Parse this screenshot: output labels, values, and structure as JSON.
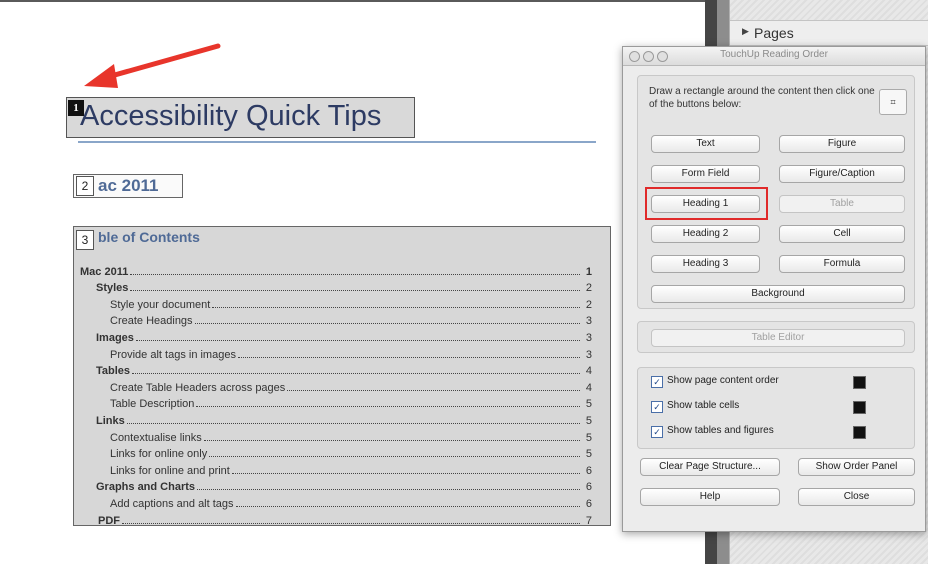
{
  "document": {
    "heading1_tag": "1",
    "heading1_text": "Accessibility Quick Tips",
    "heading2_tag": "2",
    "heading2_text": "ac 2011",
    "toc_tag": "3",
    "toc_title": "ble of Contents",
    "toc_entries": [
      {
        "label": "Mac 2011",
        "page": "1"
      },
      {
        "label": "Styles",
        "page": "2"
      },
      {
        "label": "Style your document",
        "page": "2"
      },
      {
        "label": "Create Headings",
        "page": "3"
      },
      {
        "label": "Images",
        "page": "3"
      },
      {
        "label": "Provide alt tags in images",
        "page": "3"
      },
      {
        "label": "Tables",
        "page": "4"
      },
      {
        "label": "Create Table Headers across pages",
        "page": "4"
      },
      {
        "label": "Table Description",
        "page": "5"
      },
      {
        "label": "Links",
        "page": "5"
      },
      {
        "label": "Contextualise links",
        "page": "5"
      },
      {
        "label": "Links for online only",
        "page": "5"
      },
      {
        "label": "Links for online and print",
        "page": "6"
      },
      {
        "label": "Graphs and Charts",
        "page": "6"
      },
      {
        "label": "Add captions and alt tags",
        "page": "6"
      },
      {
        "label": "PDF",
        "page": "7"
      }
    ]
  },
  "pages_panel": {
    "title": "Pages"
  },
  "dialog": {
    "title": "TouchUp Reading Order",
    "instructions": "Draw a rectangle around the content then click one of the buttons below:",
    "buttons": {
      "text": "Text",
      "figure": "Figure",
      "form_field": "Form Field",
      "figure_caption": "Figure/Caption",
      "heading1": "Heading 1",
      "table": "Table",
      "heading2": "Heading 2",
      "cell": "Cell",
      "heading3": "Heading 3",
      "formula": "Formula",
      "background": "Background",
      "table_editor": "Table Editor",
      "clear_page_structure": "Clear Page Structure...",
      "show_order_panel": "Show Order Panel",
      "help": "Help",
      "close": "Close"
    },
    "checkboxes": [
      {
        "label": "Show page content order",
        "checked": true
      },
      {
        "label": "Show table cells",
        "checked": true
      },
      {
        "label": "Show tables and figures",
        "checked": true
      }
    ],
    "check_mark": "✓",
    "highlight_color": "#e02a2a"
  }
}
